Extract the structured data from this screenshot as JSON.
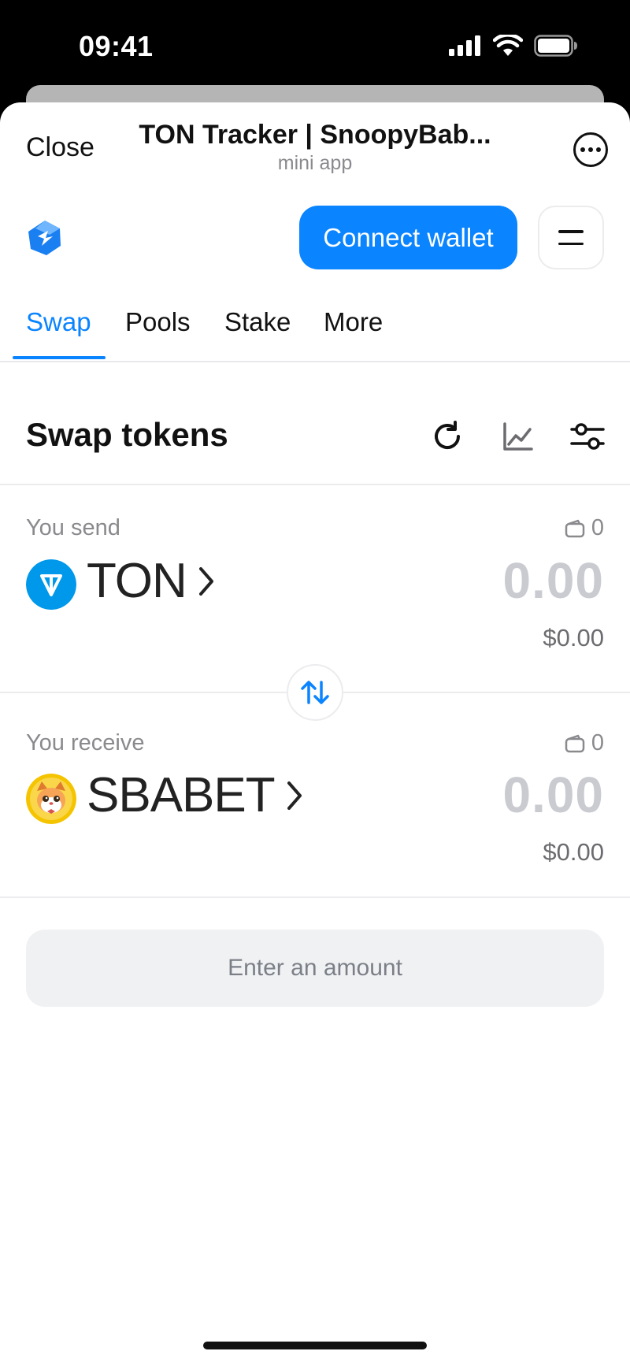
{
  "status_bar": {
    "time": "09:41"
  },
  "telegram_header": {
    "close_label": "Close",
    "title": "TON Tracker | SnoopyBab...",
    "subtitle": "mini app"
  },
  "app_bar": {
    "connect_label": "Connect wallet"
  },
  "tabs": [
    {
      "label": "Swap",
      "active": true
    },
    {
      "label": "Pools",
      "active": false
    },
    {
      "label": "Stake",
      "active": false
    },
    {
      "label": "More",
      "active": false
    }
  ],
  "swap": {
    "title": "Swap tokens",
    "send": {
      "label": "You send",
      "balance": "0",
      "token": "TON",
      "amount": "0.00",
      "usd": "$0.00"
    },
    "receive": {
      "label": "You receive",
      "balance": "0",
      "token": "SBABET",
      "amount": "0.00",
      "usd": "$0.00"
    },
    "action_label": "Enter an amount"
  },
  "colors": {
    "accent": "#0a84ff",
    "ton_blue": "#0098ea",
    "amount_placeholder": "#c9cbd0"
  },
  "icons": [
    "signal-icon",
    "wifi-icon",
    "battery-icon",
    "more-icon",
    "logo-icon",
    "menu-icon",
    "refresh-icon",
    "chart-icon",
    "settings-sliders-icon",
    "wallet-icon",
    "ton-logo-icon",
    "chevron-right-icon",
    "swap-direction-icon",
    "sbabet-token-icon"
  ]
}
